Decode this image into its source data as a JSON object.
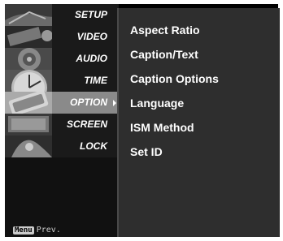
{
  "menu": {
    "items": [
      {
        "label": "SETUP",
        "icon": "setup-icon",
        "selected": false
      },
      {
        "label": "VIDEO",
        "icon": "video-icon",
        "selected": false
      },
      {
        "label": "AUDIO",
        "icon": "audio-icon",
        "selected": false
      },
      {
        "label": "TIME",
        "icon": "time-icon",
        "selected": false
      },
      {
        "label": "OPTION",
        "icon": "option-icon",
        "selected": true
      },
      {
        "label": "SCREEN",
        "icon": "screen-icon",
        "selected": false
      },
      {
        "label": "LOCK",
        "icon": "lock-icon",
        "selected": false
      }
    ],
    "prev_key": "Menu",
    "prev_label": "Prev."
  },
  "submenu": {
    "items": [
      {
        "label": "Aspect Ratio"
      },
      {
        "label": "Caption/Text"
      },
      {
        "label": "Caption Options"
      },
      {
        "label": "Language"
      },
      {
        "label": "ISM Method"
      },
      {
        "label": "Set ID"
      }
    ]
  },
  "colors": {
    "panel_bg": "#2e2e2e",
    "selected_bar": "#8a8a8a",
    "text": "#ffffff"
  }
}
